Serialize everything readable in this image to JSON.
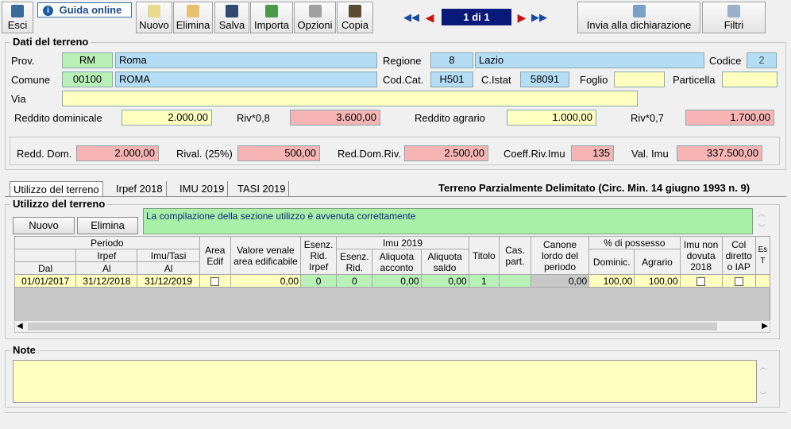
{
  "toolbar": {
    "esci": "Esci",
    "guida": "Guida online",
    "nuovo": "Nuovo",
    "elimina": "Elimina",
    "salva": "Salva",
    "importa": "Importa",
    "opzioni": "Opzioni",
    "copia": "Copia",
    "page": "1 di 1",
    "invia": "Invia alla dichiarazione",
    "filtri": "Filtri"
  },
  "dati": {
    "legend": "Dati del terreno",
    "prov_label": "Prov.",
    "prov_code": "RM",
    "prov_name": "Roma",
    "regione_label": "Regione",
    "regione_code": "8",
    "regione_name": "Lazio",
    "codice_label": "Codice",
    "codice_value": "2",
    "comune_label": "Comune",
    "comune_cap": "00100",
    "comune_name": "ROMA",
    "codcat_label": "Cod.Cat.",
    "codcat_value": "H501",
    "cistat_label": "C.Istat",
    "cistat_value": "58091",
    "foglio_label": "Foglio",
    "foglio_value": "",
    "particella_label": "Particella",
    "particella_value": "",
    "via_label": "Via",
    "via_value": "",
    "rd_label": "Reddito dominicale",
    "rd_value": "2.000,00",
    "riv08_label": "Riv*0,8",
    "riv08_value": "3.600,00",
    "ra_label": "Reddito agrario",
    "ra_value": "1.000,00",
    "riv07_label": "Riv*0,7",
    "riv07_value": "1.700,00",
    "redddom_label": "Redd. Dom.",
    "redddom_value": "2.000,00",
    "rival_label": "Rival. (25%)",
    "rival_value": "500,00",
    "reddomriv_label": "Red.Dom.Riv.",
    "reddomriv_value": "2.500,00",
    "coeff_label": "Coeff.Riv.Imu",
    "coeff_value": "135",
    "valimu_label": "Val. Imu",
    "valimu_value": "337.500,00"
  },
  "tabs": [
    "Utilizzo del terreno",
    "Irpef 2018",
    "IMU 2019",
    "TASI 2019"
  ],
  "terreno_note": "Terreno Parzialmente Delimitato (Circ. Min. 14 giugno 1993 n. 9)",
  "utilizzo": {
    "legend": "Utilizzo del terreno",
    "nuovo": "Nuovo",
    "elimina": "Elimina",
    "message": "La compilazione della sezione utilizzo è avvenuta correttamente"
  },
  "grid": {
    "h_periodo": "Periodo",
    "h_irpef": "Irpef",
    "h_imutasi": "Imu/Tasi",
    "h_dal": "Dal",
    "h_al1": "Al",
    "h_al2": "Al",
    "h_area": "Area Edif",
    "h_valore": "Valore venale area edificabile",
    "h_esenz_irpef": "Esenz. Rid. Irpef",
    "h_imu2019": "Imu 2019",
    "h_esenz_rid": "Esenz. Rid.",
    "h_aliq_acconto": "Aliquota acconto",
    "h_aliq_saldo": "Aliquota saldo",
    "h_titolo": "Titolo",
    "h_cas": "Cas. part.",
    "h_canone": "Canone lordo del periodo",
    "h_possesso": "% di possesso",
    "h_dominic": "Dominic.",
    "h_agrario": "Agrario",
    "h_imunon": "Imu non dovuta 2018",
    "h_col": "Col diretto o IAP",
    "h_es": "Es T",
    "row": {
      "dal": "01/01/2017",
      "al_irpef": "31/12/2018",
      "al_imu": "31/12/2019",
      "valore": "0,00",
      "esenz_irpef": "0",
      "esenz_rid": "0",
      "acconto": "0,00",
      "saldo": "0,00",
      "titolo": "1",
      "cas": "",
      "canone": "0,00",
      "dominic": "100,00",
      "agrario": "100,00"
    }
  },
  "note": {
    "legend": "Note",
    "value": ""
  }
}
